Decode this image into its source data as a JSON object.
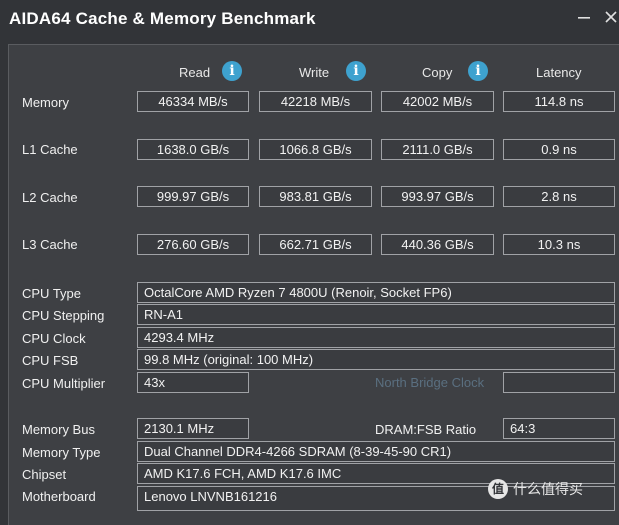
{
  "window": {
    "title": "AIDA64 Cache & Memory Benchmark"
  },
  "columns": {
    "read": "Read",
    "write": "Write",
    "copy": "Copy",
    "latency": "Latency"
  },
  "bench": [
    {
      "label": "Memory",
      "read": "46334 MB/s",
      "write": "42218 MB/s",
      "copy": "42002 MB/s",
      "latency": "114.8 ns"
    },
    {
      "label": "L1 Cache",
      "read": "1638.0 GB/s",
      "write": "1066.8 GB/s",
      "copy": "2111.0 GB/s",
      "latency": "0.9 ns"
    },
    {
      "label": "L2 Cache",
      "read": "999.97 GB/s",
      "write": "983.81 GB/s",
      "copy": "993.97 GB/s",
      "latency": "2.8 ns"
    },
    {
      "label": "L3 Cache",
      "read": "276.60 GB/s",
      "write": "662.71 GB/s",
      "copy": "440.36 GB/s",
      "latency": "10.3 ns"
    }
  ],
  "cpu": {
    "type_label": "CPU Type",
    "type_value": "OctalCore AMD Ryzen 7 4800U  (Renoir, Socket FP6)",
    "stepping_label": "CPU Stepping",
    "stepping_value": "RN-A1",
    "clock_label": "CPU Clock",
    "clock_value": "4293.4 MHz",
    "fsb_label": "CPU FSB",
    "fsb_value": "99.8 MHz  (original: 100 MHz)",
    "multiplier_label": "CPU Multiplier",
    "multiplier_value": "43x",
    "nb_clock_label": "North Bridge Clock",
    "nb_clock_value": ""
  },
  "memory": {
    "bus_label": "Memory Bus",
    "bus_value": "2130.1 MHz",
    "dram_ratio_label": "DRAM:FSB Ratio",
    "dram_ratio_value": "64:3",
    "type_label": "Memory Type",
    "type_value": "Dual Channel DDR4-4266 SDRAM  (8-39-45-90 CR1)",
    "chipset_label": "Chipset",
    "chipset_value": "AMD K17.6 FCH, AMD K17.6 IMC",
    "motherboard_label": "Motherboard",
    "motherboard_value": "Lenovo LNVNB161216"
  },
  "watermark": {
    "logo": "值",
    "text": "什么值得买"
  },
  "icons": {
    "info": "info-circle-icon",
    "minimize": "minimize-icon",
    "close": "close-icon"
  },
  "colors": {
    "background": "#323438",
    "panel": "#3e4044",
    "info": "#3ea2cf",
    "disabled_text": "#5a6f80"
  }
}
